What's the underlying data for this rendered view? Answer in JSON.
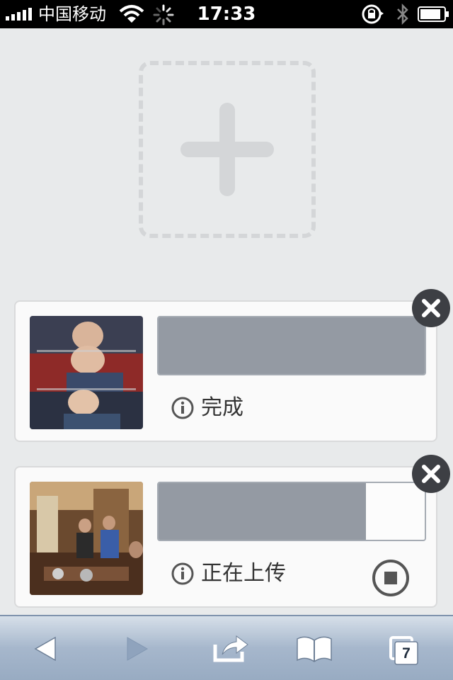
{
  "status_bar": {
    "carrier": "中国移动",
    "time": "17:33"
  },
  "uploads": [
    {
      "status": "完成",
      "progress": 1.0,
      "thumbnail": "photo-comedian-collage"
    },
    {
      "status": "正在上传",
      "progress": 0.78,
      "thumbnail": "photo-restaurant-people"
    }
  ],
  "toolbar": {
    "tabs_count": "7"
  },
  "icons": [
    "signal-icon",
    "wifi-icon",
    "activity-spinner-icon",
    "rotation-lock-icon",
    "bluetooth-icon",
    "battery-icon",
    "plus-icon",
    "close-icon",
    "info-icon",
    "stop-icon",
    "back-icon",
    "forward-icon",
    "share-icon",
    "bookmarks-icon",
    "tabs-icon"
  ],
  "colors": {
    "background": "#e8eaeb",
    "progress_fill": "#949aa3",
    "close_button": "#3d3f44",
    "toolbar": "#a6b7cc"
  }
}
